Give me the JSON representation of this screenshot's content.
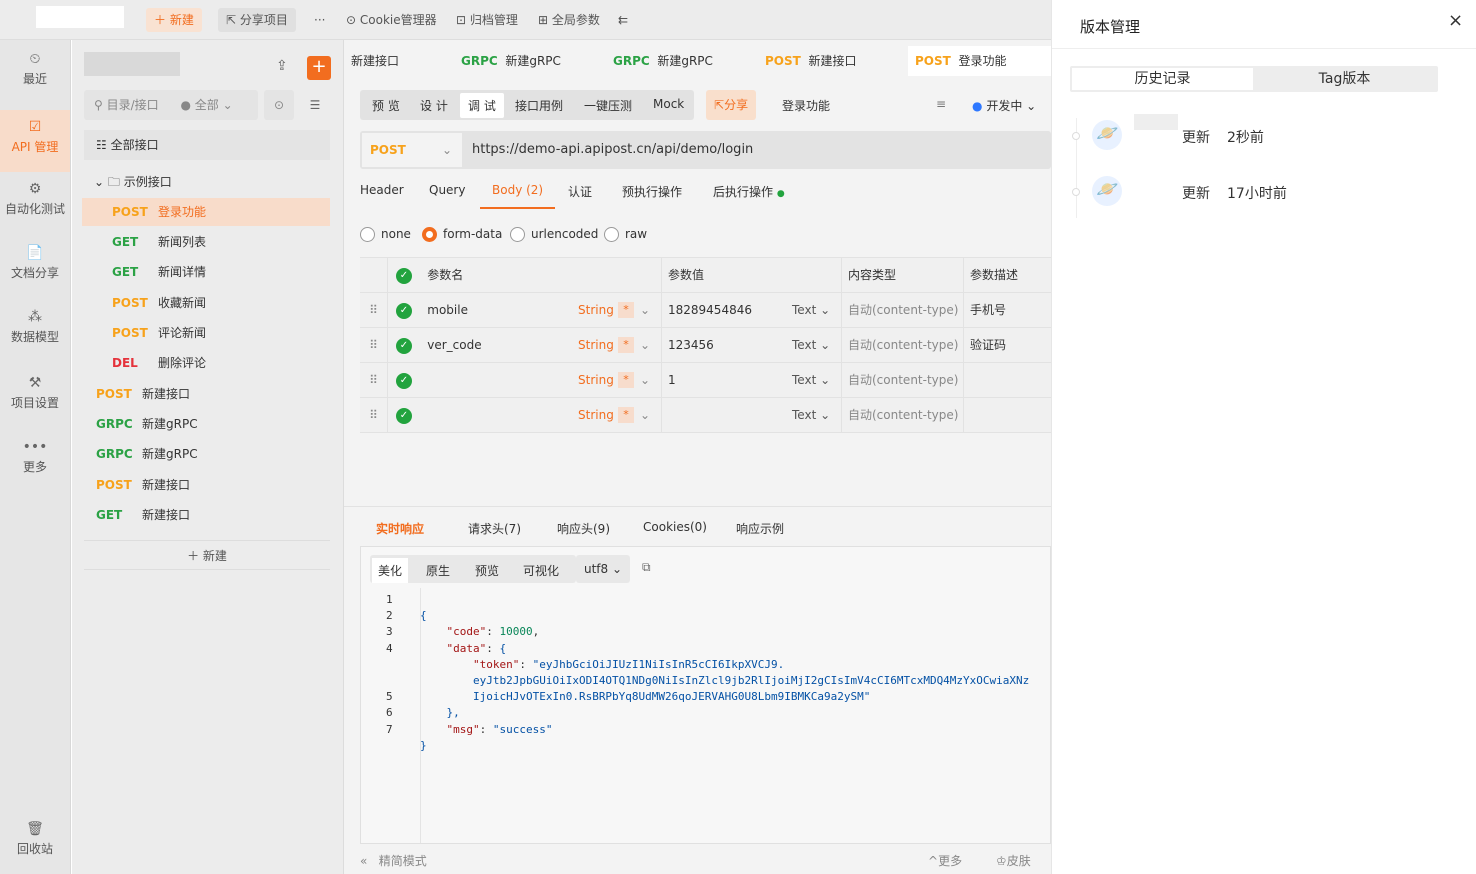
{
  "topbar": {
    "new_label": "新建",
    "share_label": "分享项目",
    "more_label": "···",
    "cookie_label": "Cookie管理器",
    "archive_label": "归档管理",
    "global_label": "全局参数"
  },
  "nav": [
    {
      "name": "recent",
      "label": "最近",
      "icon": "⏲"
    },
    {
      "name": "api",
      "label": "API 管理",
      "icon": "☑"
    },
    {
      "name": "auto",
      "label": "自动化测试",
      "icon": "⚙"
    },
    {
      "name": "doc",
      "label": "文档分享",
      "icon": "📄"
    },
    {
      "name": "model",
      "label": "数据模型",
      "icon": "⁂"
    },
    {
      "name": "settings",
      "label": "项目设置",
      "icon": "⚒"
    },
    {
      "name": "more",
      "label": "更多",
      "icon": "•••"
    },
    {
      "name": "trash",
      "label": "回收站",
      "icon": "🗑"
    }
  ],
  "tree": {
    "search_placeholder": "目录/接口",
    "filter_label": "全部",
    "all_label": "全部接口",
    "folder_label": "示例接口",
    "new_label": "新建",
    "items": [
      {
        "method": "POST",
        "label": "登录功能"
      },
      {
        "method": "GET",
        "label": "新闻列表"
      },
      {
        "method": "GET",
        "label": "新闻详情"
      },
      {
        "method": "POST",
        "label": "收藏新闻"
      },
      {
        "method": "POST",
        "label": "评论新闻"
      },
      {
        "method": "DEL",
        "label": "删除评论"
      },
      {
        "method": "POST",
        "label": "新建接口"
      },
      {
        "method": "GRPC",
        "label": "新建gRPC"
      },
      {
        "method": "GRPC",
        "label": "新建gRPC"
      },
      {
        "method": "POST",
        "label": "新建接口"
      },
      {
        "method": "GET",
        "label": "新建接口"
      }
    ]
  },
  "tabs": [
    {
      "method": "",
      "label": "新建接口"
    },
    {
      "method": "GRPC",
      "label": "新建gRPC"
    },
    {
      "method": "GRPC",
      "label": "新建gRPC"
    },
    {
      "method": "POST",
      "label": "新建接口"
    },
    {
      "method": "POST",
      "label": "登录功能"
    }
  ],
  "modes": [
    "预 览",
    "设 计",
    "调 试",
    "接口用例",
    "一键压测",
    "Mock"
  ],
  "share_label": "分享",
  "api_name": "登录功能",
  "status_label": "开发中",
  "request": {
    "method": "POST",
    "url": "https://demo-api.apipost.cn/api/demo/login"
  },
  "req_tabs": [
    "Header",
    "Query",
    "Body (2)",
    "认证",
    "预执行操作",
    "后执行操作"
  ],
  "body_types": [
    "none",
    "form-data",
    "urlencoded",
    "raw"
  ],
  "params_header": {
    "name": "参数名",
    "value": "参数值",
    "ctype": "内容类型",
    "desc": "参数描述"
  },
  "params": [
    {
      "name": "mobile",
      "type": "String",
      "req": "*",
      "value": "18289454846",
      "vtype": "Text",
      "ctype": "自动(content-type)",
      "desc": "手机号"
    },
    {
      "name": "ver_code",
      "type": "String",
      "req": "*",
      "value": "123456",
      "vtype": "Text",
      "ctype": "自动(content-type)",
      "desc": "验证码"
    },
    {
      "name": "",
      "type": "String",
      "req": "*",
      "value": "1",
      "vtype": "Text",
      "ctype": "自动(content-type)",
      "desc": ""
    },
    {
      "name": "",
      "type": "String",
      "req": "*",
      "value": "",
      "vtype": "Text",
      "ctype": "自动(content-type)",
      "desc": ""
    }
  ],
  "resp_tabs": [
    "实时响应",
    "请求头(7)",
    "响应头(9)",
    "Cookies(0)",
    "响应示例"
  ],
  "resp_modes": [
    "美化",
    "原生",
    "预览",
    "可视化"
  ],
  "encoding": "utf8",
  "code_lines": [
    "1",
    "2",
    "3",
    "4",
    "",
    "",
    "5",
    "6",
    "7"
  ],
  "code": {
    "l1": "{",
    "k_code": "\"code\"",
    "v_code": "10000",
    "k_data": "\"data\"",
    "k_token": "\"token\"",
    "v_token1": "\"eyJhbGciOiJIUzI1NiIsInR5cCI6IkpXVCJ9.",
    "v_token2": "eyJtb2JpbGUiOiIxODI4OTQ1NDg0NiIsInZlcl9jb2RlIjoiMjI2gCIsImV4cCI6MTcxMDQ4MzYxOCwiaXNz",
    "v_token3": "IjoicHJvOTExIn0.RsBRPbYq8UdMW26qoJERVAHG0U8Lbm9IBMKCa9a2ySM\"",
    "l5": "},",
    "k_msg": "\"msg\"",
    "v_msg": "\"success\"",
    "l7": "}"
  },
  "footer": {
    "simple_label": "精简模式",
    "more_label": "更多",
    "skin_label": "皮肤"
  },
  "panel": {
    "title": "版本管理",
    "close": "×",
    "tab_history": "历史记录",
    "tab_tag": "Tag版本",
    "history": [
      {
        "action": "更新",
        "time": "2秒前"
      },
      {
        "action": "更新",
        "time": "17小时前"
      }
    ]
  }
}
